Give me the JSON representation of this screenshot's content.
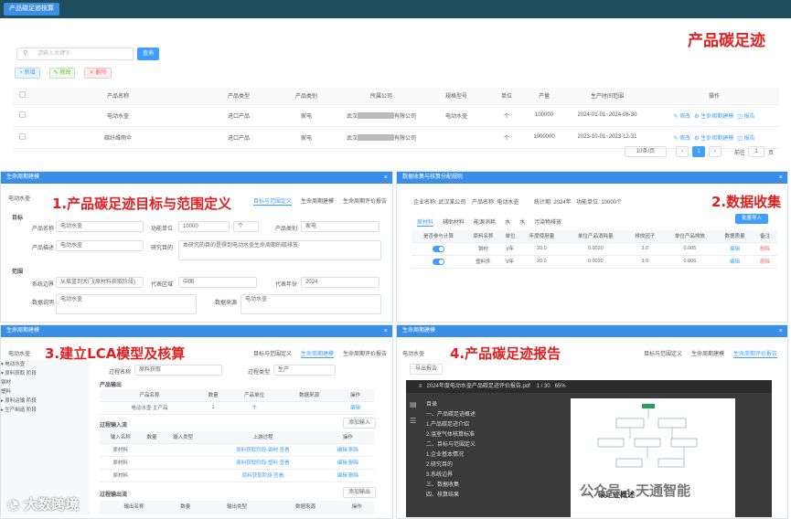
{
  "top": {
    "tab": "产品碳足迹核算"
  },
  "main": {
    "title": "产品碳足迹",
    "search_placeholder": "请输入关键字",
    "query_label": "查询",
    "actions": {
      "add": "+ 新增",
      "edit": "✎ 修改",
      "del": "✕ 删除"
    },
    "columns": [
      "产品名称",
      "产品类型",
      "产品类别",
      "所属公司",
      "规格型号",
      "单位",
      "产量",
      "生产时间范围",
      "操作"
    ],
    "rows": [
      {
        "name": "电动水壶",
        "type": "进口产品",
        "cat": "家电",
        "company_a": "武汉",
        "company_b": "有限公司",
        "model": "电动水壶",
        "unit": "个",
        "qty": "100000",
        "range": "2024-01-01~2024-06-30"
      },
      {
        "name": "碳纤维雨伞",
        "type": "进口产品",
        "cat": "家电",
        "company_a": "武汉",
        "company_b": "有限公司",
        "model": "",
        "unit": "个",
        "qty": "1000000",
        "range": "2023-10-01~2023-12-31"
      }
    ],
    "row_ops": [
      "✎ 修改",
      "⚙ 生命周期建模",
      "◫ 报告"
    ],
    "pager": {
      "size": "10条/页",
      "page": "1",
      "goto_label": "前往",
      "goto_value": "1",
      "page_suffix": "页"
    }
  },
  "p1": {
    "header": "生命周期建模",
    "title": "1.产品碳足迹目标与范围定义",
    "tabs": [
      "目标与范围定义",
      "生命周期建模",
      "生命周期评价报告"
    ],
    "section1": "目标",
    "section2": "范围",
    "fields": {
      "product_name_label": "产品名称",
      "product_name": "电动水壶",
      "func_unit_label": "功能单位",
      "func_unit": "10000",
      "unit_sel": "个",
      "cat_label": "产品类别",
      "cat": "家电",
      "desc_label": "产品描述",
      "desc": "电动水壶",
      "purpose_label": "研究目的",
      "purpose": "本研究的目的是得到电动水壶生命周期的碳排放",
      "boundary_label": "系统边界",
      "boundary": "从摇篮到大门(原材料获取阶段)",
      "region_label": "代表区域",
      "region": "中国",
      "year_label": "代表年份",
      "year": "2024",
      "note_label": "数据说明",
      "note": "电动水壶",
      "data_label": "数据来源",
      "data": "电动水壶"
    }
  },
  "p2": {
    "header": "数据收集与核算分配规则",
    "title": "2.数据收集",
    "info": [
      "企业名称: 武汉某公司",
      "产品名称: 电动水壶",
      "统计期: 2024年",
      "功能单位: 10000个"
    ],
    "tabs": [
      "原材料",
      "辅助材料",
      "能源消耗",
      "水",
      "水",
      "污染物排放"
    ],
    "add_btn": "批量导入",
    "cols": [
      "是否参与计算",
      "原料名称",
      "单位",
      "年度使用量",
      "单位产品消耗量",
      "排放因子",
      "单位产品排放",
      "数据质量",
      "备注"
    ],
    "rows": [
      {
        "name": "钢材",
        "unit": "t/年",
        "year": "20.0",
        "per": "0.0020",
        "ef": "2.0",
        "emit": "0.005",
        "ops": [
          "编辑",
          "删除"
        ]
      },
      {
        "name": "塑料件",
        "unit": "t/年",
        "year": "20.0",
        "per": "0.0020",
        "ef": "3.0",
        "emit": "0.006",
        "ops": [
          "编辑",
          "删除"
        ]
      }
    ]
  },
  "p3": {
    "header": "生命周期建模",
    "title": "3.建立LCA模型及核算",
    "tabs": [
      "目标与范围定义",
      "生命周期建模",
      "生命周期评价报告"
    ],
    "tree_title": "电动水壶",
    "tree": [
      "▾ 电动水壶",
      "  ▾ 原料获取 阶段",
      "    钢材",
      "    塑料",
      "  ▸ 原料运输 阶段",
      "  ▸ 生产制造 阶段"
    ],
    "proc_label": "过程名称",
    "proc_value": "原料获取",
    "type_label": "过程类型",
    "type_value": "生产",
    "out_title": "产品输出",
    "out_cols": [
      "产品名称",
      "数量",
      "产品单位",
      "数据来源",
      "操作"
    ],
    "out_row": [
      "电动水壶 主产品",
      "1",
      "个",
      "",
      "编辑"
    ],
    "in_title": "过程输入流",
    "in_btn": "添加输入",
    "in_cols": [
      "输入名称",
      "数量",
      "输入类型",
      "上游过程",
      "操作"
    ],
    "in_rows": [
      [
        "原材料",
        "",
        "",
        "原料获取阶段-钢材 查看",
        "编辑 删除"
      ],
      [
        "原材料",
        "",
        "",
        "原料获取阶段-塑料 查看",
        "编辑 删除"
      ],
      [
        "原材料",
        "",
        "",
        "原料获取阶段 查看",
        "编辑 删除"
      ]
    ],
    "out2_title": "过程输出流",
    "out2_btn": "添加输出",
    "out2_cols": [
      "输出名称",
      "数量",
      "输出类型",
      "数据来源",
      "操作"
    ]
  },
  "p4": {
    "header": "生命周期建模",
    "title": "4.产品碳足迹报告",
    "tabs": [
      "目标与范围定义",
      "生命周期建模",
      "生命周期评价报告"
    ],
    "tree_title": "电动水壶",
    "btn": "导出报告",
    "pdf_title": "2024年度电动水壶产品碳足迹评价报告.pdf",
    "page": "1 / 30",
    "zoom": "65%",
    "toc": [
      "目录",
      "一、产品碳足迹概述",
      "1.产品碳足迹介绍",
      "2.温室气体核算标准",
      "二、目标与范围定义",
      "1.企业基本情况",
      "2.研究目的",
      "3.系统边界",
      "三、数据收集",
      "四、核算结果"
    ],
    "page_heading": "一、碳足迹概述",
    "watermark": "公众号 · 天通智能"
  },
  "brand": "大数跨境"
}
